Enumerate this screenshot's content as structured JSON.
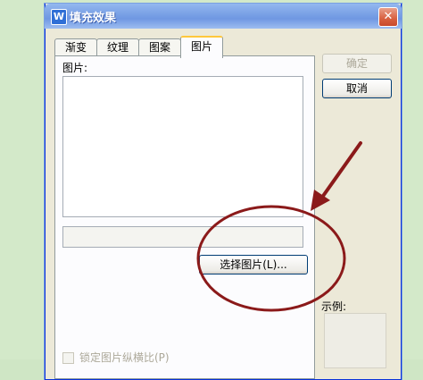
{
  "dialog": {
    "title": "填充效果",
    "app_icon_glyph": "W",
    "close_glyph": "✕"
  },
  "tabs": [
    {
      "label": "渐变"
    },
    {
      "label": "纹理"
    },
    {
      "label": "图案"
    },
    {
      "label": "图片",
      "active": true
    }
  ],
  "panel": {
    "picture_label": "图片:",
    "path_value": "",
    "select_button_label": "选择图片(L)...",
    "lock_aspect_label": "锁定图片纵横比(P)",
    "lock_aspect_checked": false
  },
  "buttons": {
    "ok_label": "确定",
    "ok_enabled": false,
    "cancel_label": "取消"
  },
  "sample": {
    "label": "示例:"
  },
  "annotation": {
    "color": "#8b1a1a"
  }
}
